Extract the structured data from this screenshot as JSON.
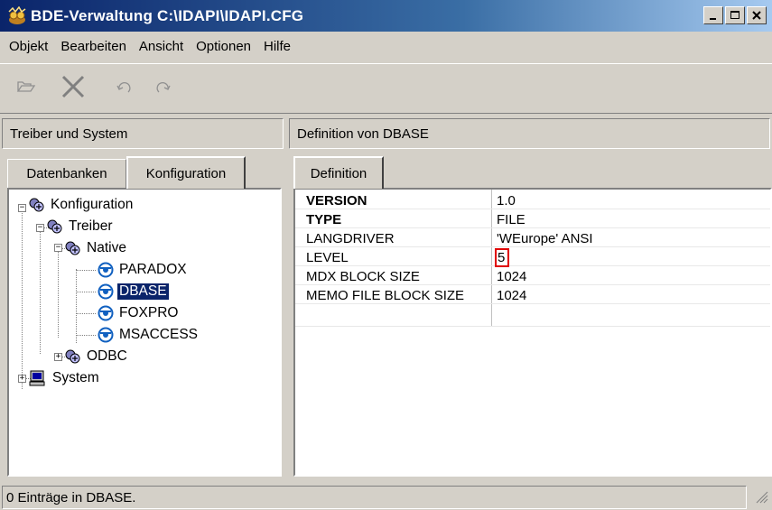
{
  "window": {
    "title": "BDE-Verwaltung  C:\\IDAPI\\IDAPI.CFG",
    "controls": [
      "minimize",
      "maximize",
      "close"
    ]
  },
  "menu": {
    "items": [
      {
        "label": "Objekt"
      },
      {
        "label": "Bearbeiten"
      },
      {
        "label": "Ansicht"
      },
      {
        "label": "Optionen"
      },
      {
        "label": "Hilfe"
      }
    ]
  },
  "toolbar": {
    "icons": [
      "open-icon",
      "delete-icon",
      "undo-icon",
      "redo-icon"
    ]
  },
  "left_panel": {
    "header": "Treiber und System",
    "tabs": [
      {
        "label": "Datenbanken",
        "active": false
      },
      {
        "label": "Konfiguration",
        "active": true
      }
    ],
    "tree": [
      {
        "label": "Konfiguration"
      },
      {
        "label": "Treiber"
      },
      {
        "label": "Native"
      },
      {
        "label": "PARADOX"
      },
      {
        "label": "DBASE",
        "selected": true
      },
      {
        "label": "FOXPRO"
      },
      {
        "label": "MSACCESS"
      },
      {
        "label": "ODBC"
      },
      {
        "label": "System"
      }
    ]
  },
  "right_panel": {
    "header": "Definition von DBASE",
    "tabs": [
      {
        "label": "Definition",
        "active": true
      }
    ],
    "rows": [
      {
        "key": "VERSION",
        "value": "1.0",
        "bold": true
      },
      {
        "key": "TYPE",
        "value": "FILE",
        "bold": true
      },
      {
        "key": "LANGDRIVER",
        "value": "'WEurope' ANSI",
        "bold": false
      },
      {
        "key": "LEVEL",
        "value": "5",
        "bold": false,
        "highlighted": true
      },
      {
        "key": "MDX BLOCK SIZE",
        "value": "1024",
        "bold": false
      },
      {
        "key": "MEMO FILE BLOCK SIZE",
        "value": "1024",
        "bold": false
      }
    ]
  },
  "status": {
    "text": "0 Einträge in DBASE."
  },
  "colors": {
    "title_start": "#0a246a",
    "title_end": "#a6caf0",
    "face": "#d4d0c8",
    "selection": "#0a246a",
    "highlight_border": "#e00000"
  }
}
